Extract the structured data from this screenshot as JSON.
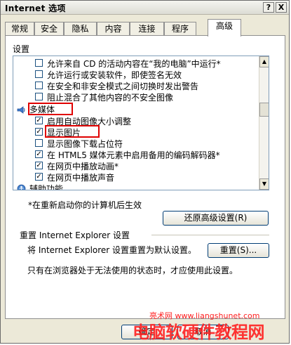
{
  "window": {
    "title": "Internet 选项",
    "help_glyph": "?",
    "close_glyph": "X"
  },
  "tabs": [
    {
      "label": "常规"
    },
    {
      "label": "安全"
    },
    {
      "label": "隐私"
    },
    {
      "label": "内容"
    },
    {
      "label": "连接"
    },
    {
      "label": "程序"
    },
    {
      "label": "高级",
      "active": true
    }
  ],
  "settings": {
    "heading": "设置",
    "items": [
      {
        "label": "允许来自 CD 的活动内容在“我的电脑”中运行*",
        "checked": false
      },
      {
        "label": "允许运行或安装软件，即使签名无效",
        "checked": false
      },
      {
        "label": "在安全和非安全模式之间切换时发出警告",
        "checked": false
      },
      {
        "label": "阻止混合了其他内容的不安全图像",
        "checked": false
      },
      {
        "label": "多媒体",
        "category": true
      },
      {
        "label": "启用自动图像大小调整",
        "checked": true
      },
      {
        "label": "显示图片",
        "checked": true
      },
      {
        "label": "显示图像下载占位符",
        "checked": false
      },
      {
        "label": "在 HTML5 媒体元素中启用备用的编码解码器*",
        "checked": true
      },
      {
        "label": "在网页中播放动画*",
        "checked": true
      },
      {
        "label": "在网页中播放声音",
        "checked": true
      },
      {
        "label": "辅助功能",
        "category": true
      }
    ],
    "restart_note": "*在重新启动你的计算机后生效",
    "restore_button": "还原高级设置(R)"
  },
  "reset": {
    "heading": "重置 Internet Explorer 设置",
    "description": "将 Internet Explorer 设置重置为默认设置。",
    "button": "重置(S)...",
    "note": "只有在浏览器处于无法使用的状态时，才应使用此设置。"
  },
  "footer": {
    "ok": "确定",
    "cancel": "取消"
  },
  "watermark": {
    "site": "亮术网 www.liangshunet.com",
    "brand": "电脑软硬件教程网"
  }
}
